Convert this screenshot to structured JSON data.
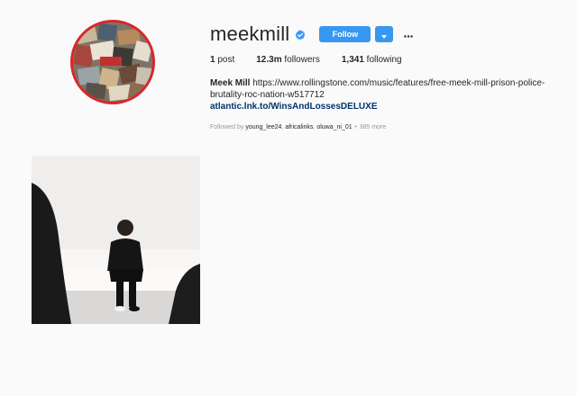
{
  "profile": {
    "username": "meekmill",
    "follow_label": "Follow",
    "stats": {
      "posts_count": "1",
      "posts_label": "post",
      "followers_count": "12.3m",
      "followers_label": "followers",
      "following_count": "1,341",
      "following_label": "following"
    },
    "bio": {
      "name": "Meek Mill",
      "text": "https://www.rollingstone.com/music/features/free-meek-mill-prison-police-brutality-roc-nation-w517712",
      "link": "atlantic.lnk.to/WinsAndLossesDELUXE"
    },
    "followed_by": {
      "prefix": "Followed by",
      "users": [
        "young_lee24",
        "africalinks",
        "oluwa_ni_01"
      ],
      "more": "+ 385 more"
    }
  },
  "icons": {
    "verified": "verified-badge-icon",
    "dropdown": "caret-down-icon",
    "options": "more-options-icon"
  },
  "colors": {
    "background": "#fafafa",
    "accent": "#3897f0",
    "link": "#003569",
    "avatar_ring": "#d7282b",
    "muted": "#999999"
  }
}
